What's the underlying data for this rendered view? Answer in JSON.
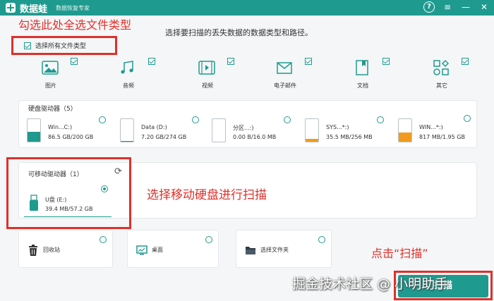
{
  "app": {
    "name": "数据蛙",
    "subtitle": "数据恢复专家",
    "controls": {
      "help": "?",
      "menu": "≡",
      "minimize": "—",
      "close": "✕"
    }
  },
  "annotations": {
    "select_all_tip": "勾选此处全选文件类型",
    "select_drive_tip": "选择移动硬盘进行扫描",
    "click_scan_tip": "点击“扫描”"
  },
  "hint": "选择要扫描的丢失数据的数据类型和路径。",
  "select_all": {
    "label": "选择所有文件类型",
    "checked": true
  },
  "file_types": [
    {
      "label": "图片",
      "icon": "image-icon",
      "checked": true
    },
    {
      "label": "音频",
      "icon": "music-icon",
      "checked": true
    },
    {
      "label": "视频",
      "icon": "video-icon",
      "checked": true
    },
    {
      "label": "电子邮件",
      "icon": "email-icon",
      "checked": true
    },
    {
      "label": "文档",
      "icon": "document-icon",
      "checked": true
    },
    {
      "label": "其它",
      "icon": "other-icon",
      "checked": true
    }
  ],
  "hard_drives": {
    "title": "硬盘驱动器（5）",
    "items": [
      {
        "name": "Win...C:)",
        "size": "86.5 GB/200 GB",
        "fill_color": "#1f9a8f",
        "used_fraction": 0.43
      },
      {
        "name": "Data (D:)",
        "size": "7.20 GB/274 GB",
        "fill_color": "#1f9a8f",
        "used_fraction": 0.03
      },
      {
        "name": "分区...:)",
        "size": "0.00  B/16.0 MB",
        "fill_color": "#1f9a8f",
        "used_fraction": 0.0
      },
      {
        "name": "SYS...*:)",
        "size": "35.5 MB/256 MB",
        "fill_color": "#f29a1f",
        "used_fraction": 0.14
      },
      {
        "name": "WIN...*:)",
        "size": "817 MB/1.95 GB",
        "fill_color": "#f29a1f",
        "used_fraction": 0.42
      }
    ]
  },
  "removable": {
    "title": "可移动驱动器（1）",
    "items": [
      {
        "name": "U盘 (E:)",
        "size": "39.4 MB/57.2 GB",
        "selected": true
      }
    ]
  },
  "locations": [
    {
      "label": "回收站",
      "icon": "recycle-bin-icon"
    },
    {
      "label": "桌面",
      "icon": "desktop-icon"
    },
    {
      "label": "选择文件夹",
      "icon": "folder-icon"
    }
  ],
  "scan_button": {
    "label": "扫描"
  },
  "watermark": "掘金技术社区 @ 小明助手",
  "colors": {
    "accent": "#1f9a8f",
    "annotation": "#e0302a",
    "warning": "#f29a1f"
  }
}
